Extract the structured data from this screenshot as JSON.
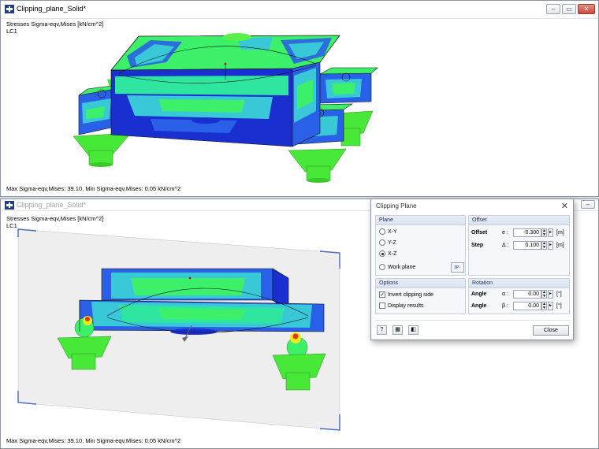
{
  "top_window": {
    "title": "Clipping_plane_Solid*",
    "info_line1": "Stresses Sigma-eqv,Mises [kN/cm^2]",
    "info_line2": "LC1",
    "status": "Max Sigma-eqv,Mises: 39.10, Min Sigma-eqv,Mises: 0.05 kN/cm^2"
  },
  "bottom_window": {
    "title": "Clipping_plane_Solid*",
    "info_line1": "Stresses Sigma-eqv,Mises [kN/cm^2]",
    "info_line2": "LC1",
    "status": "Max Sigma-eqv,Mises: 39.10, Min Sigma-eqv,Mises: 0.05 kN/cm^2"
  },
  "dialog": {
    "title": "Clipping Plane",
    "close_x": "✕",
    "plane": {
      "header": "Plane",
      "options": [
        "X-Y",
        "Y-Z",
        "X-Z"
      ],
      "selected": "X-Z",
      "work_plane": "Work plane"
    },
    "offset": {
      "header": "Offset",
      "offset_label": "Offset",
      "offset_symbol": "e :",
      "offset_value": "-0.300",
      "offset_unit": "[m]",
      "step_label": "Step",
      "step_symbol": "Δ :",
      "step_value": "0.100",
      "step_unit": "[m]"
    },
    "options": {
      "header": "Options",
      "invert_label": "Invert clipping side",
      "invert_checked": true,
      "display_label": "Display results",
      "display_checked": false
    },
    "rotation": {
      "header": "Rotation",
      "angle_label": "Angle",
      "alpha_symbol": "α :",
      "alpha_value": "0.00",
      "alpha_unit": "[°]",
      "beta_symbol": "β :",
      "beta_value": "0.00",
      "beta_unit": "[°]"
    },
    "close_button": "Close"
  },
  "colors": {
    "deep_blue": "#1a2fd0",
    "blue": "#2a60e8",
    "cyan": "#38c8d8",
    "teal": "#2fe6a0",
    "green": "#3cf06a",
    "bright_green": "#5af04a",
    "yellow": "#f2e81c",
    "red": "#e03a1a"
  }
}
